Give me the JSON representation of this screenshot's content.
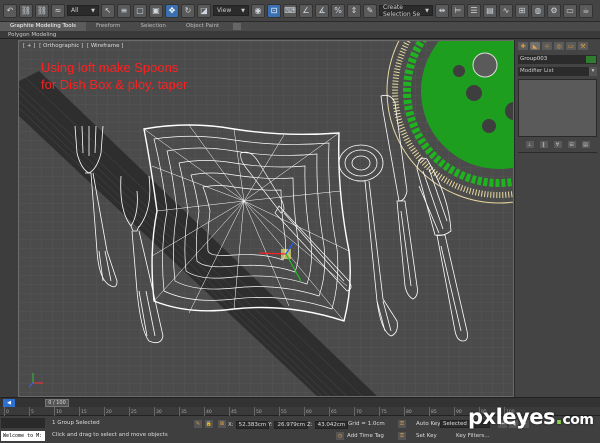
{
  "toolbar": {
    "filter_select": "All",
    "view_select": "View",
    "named_selection_select": "Create Selection Se"
  },
  "ribbon": {
    "tabs": [
      "Graphite Modeling Tools",
      "Freeform",
      "Selection",
      "Object Paint"
    ],
    "subtab": "Polygon Modeling"
  },
  "viewport": {
    "label_plus": "[ + ]",
    "label_view": "[ Orthographic ]",
    "label_shading": "[ Wireframe ]",
    "annotation_line1": "Using loft make Spoons",
    "annotation_line2": "for Dish Box & ploy. taper"
  },
  "command_panel": {
    "object_name": "Group003",
    "modifier_list": "Modifier List"
  },
  "timeline": {
    "frame_display": "0 / 100",
    "ruler_ticks": [
      "0",
      "5",
      "10",
      "15",
      "20",
      "25",
      "30",
      "35",
      "40",
      "45",
      "50",
      "55",
      "60",
      "65",
      "70",
      "75",
      "80",
      "85",
      "90",
      "95",
      "100"
    ]
  },
  "status": {
    "listener_text": "Welcome to M:",
    "selection_text": "1 Group Selected",
    "prompt_text": "Click and drag to select and move objects",
    "x_label": "X:",
    "x_value": "52.383cm",
    "y_label": "Y:",
    "y_value": "26.979cm",
    "z_label": "Z:",
    "z_value": "43.042cm",
    "grid_text": "Grid = 1.0cm",
    "add_time_tag": "Add Time Tag",
    "auto_key": "Auto Key",
    "set_key": "Set Key",
    "key_filters": "Key Filters...",
    "selected_dropdown": "Selected"
  },
  "watermark": {
    "brand": "pxleyes",
    "dot": ".",
    "tld": "com"
  },
  "colors": {
    "annotation": "#ff2020",
    "viewport_bg": "#4b4b4b",
    "wire_white": "#ffffff",
    "plate_rim": "#e8d9a0",
    "plate_green": "#1fb31f"
  }
}
